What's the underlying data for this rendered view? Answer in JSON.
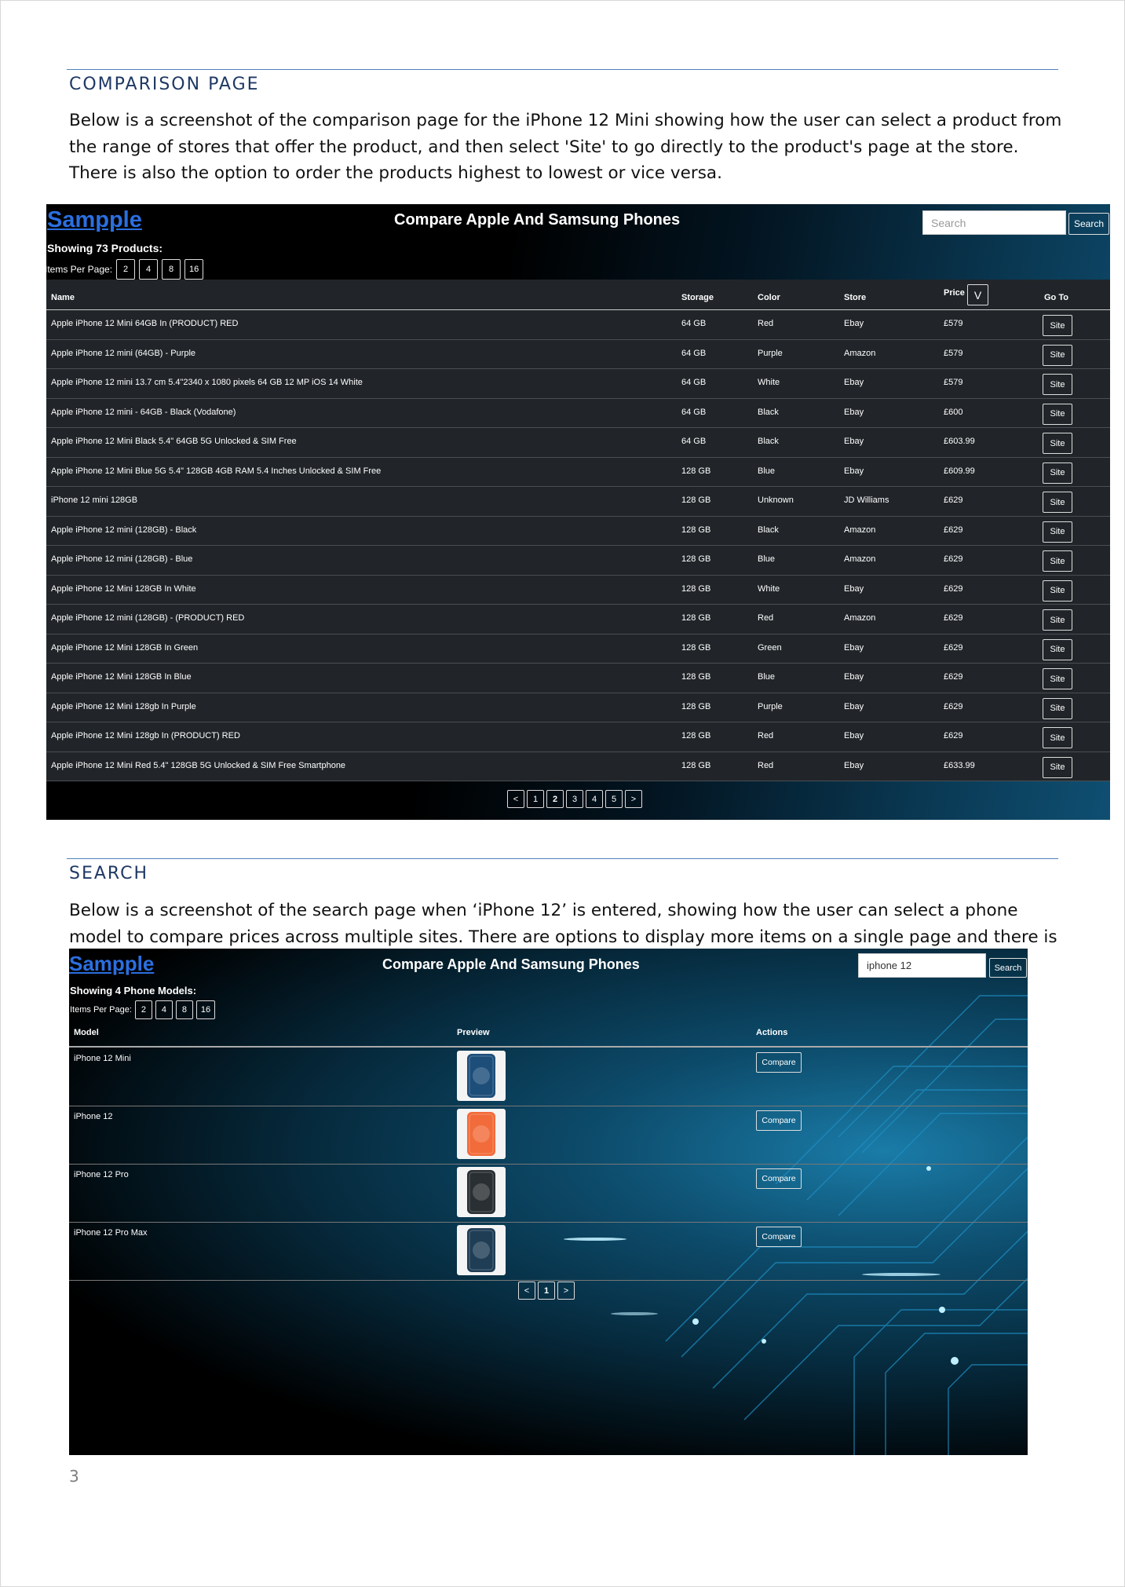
{
  "sections": [
    {
      "heading": "COMPARISON PAGE",
      "paragraph": "Below is a screenshot of the comparison page for the iPhone 12 Mini showing how the user can select a product from the range of stores that offer the product, and then select 'Site' to go directly to the product's page at the store. There is also the option to order the products highest to lowest or vice versa."
    },
    {
      "heading": "SEARCH",
      "paragraph": "Below is a screenshot of the search page when ‘iPhone 12’ is entered, showing how the user can select a phone model to compare prices across multiple sites. There are options to display more items on a single page and there is pagination."
    }
  ],
  "page_number": "3",
  "comparison_app": {
    "logo": "Sampple",
    "title": "Compare Apple And Samsung Phones",
    "search_placeholder": "Search",
    "search_button": "Search",
    "showing": "Showing 73 Products:",
    "items_per_page_label": "Items Per Page:",
    "items_per_page_options": [
      "2",
      "4",
      "8",
      "16"
    ],
    "columns": {
      "name": "Name",
      "storage": "Storage",
      "color": "Color",
      "store": "Store",
      "price": "Price",
      "goto": "Go To"
    },
    "sort_toggle": "V",
    "site_button": "Site",
    "rows": [
      {
        "name": "Apple iPhone 12 Mini 64GB In (PRODUCT) RED",
        "storage": "64 GB",
        "color": "Red",
        "store": "Ebay",
        "price": "£579"
      },
      {
        "name": "Apple iPhone 12 mini (64GB) - Purple",
        "storage": "64 GB",
        "color": "Purple",
        "store": "Amazon",
        "price": "£579"
      },
      {
        "name": "Apple iPhone 12 mini 13.7 cm 5.4\"2340 x 1080 pixels 64 GB 12 MP iOS 14 White",
        "storage": "64 GB",
        "color": "White",
        "store": "Ebay",
        "price": "£579"
      },
      {
        "name": "Apple iPhone 12 mini - 64GB - Black (Vodafone)",
        "storage": "64 GB",
        "color": "Black",
        "store": "Ebay",
        "price": "£600"
      },
      {
        "name": "Apple iPhone 12 Mini Black 5.4\" 64GB 5G Unlocked & SIM Free",
        "storage": "64 GB",
        "color": "Black",
        "store": "Ebay",
        "price": "£603.99"
      },
      {
        "name": "Apple iPhone 12 Mini Blue 5G 5.4\" 128GB 4GB RAM 5.4 Inches Unlocked & SIM Free",
        "storage": "128 GB",
        "color": "Blue",
        "store": "Ebay",
        "price": "£609.99"
      },
      {
        "name": "iPhone 12 mini 128GB",
        "storage": "128 GB",
        "color": "Unknown",
        "store": "JD Williams",
        "price": "£629"
      },
      {
        "name": "Apple iPhone 12 mini (128GB) - Black",
        "storage": "128 GB",
        "color": "Black",
        "store": "Amazon",
        "price": "£629"
      },
      {
        "name": "Apple iPhone 12 mini (128GB) - Blue",
        "storage": "128 GB",
        "color": "Blue",
        "store": "Amazon",
        "price": "£629"
      },
      {
        "name": "Apple iPhone 12 Mini 128GB In White",
        "storage": "128 GB",
        "color": "White",
        "store": "Ebay",
        "price": "£629"
      },
      {
        "name": "Apple iPhone 12 mini (128GB) - (PRODUCT) RED",
        "storage": "128 GB",
        "color": "Red",
        "store": "Amazon",
        "price": "£629"
      },
      {
        "name": "Apple iPhone 12 Mini 128GB In Green",
        "storage": "128 GB",
        "color": "Green",
        "store": "Ebay",
        "price": "£629"
      },
      {
        "name": "Apple iPhone 12 Mini 128GB In Blue",
        "storage": "128 GB",
        "color": "Blue",
        "store": "Ebay",
        "price": "£629"
      },
      {
        "name": "Apple iPhone 12 Mini 128gb In Purple",
        "storage": "128 GB",
        "color": "Purple",
        "store": "Ebay",
        "price": "£629"
      },
      {
        "name": "Apple iPhone 12 Mini 128gb In (PRODUCT) RED",
        "storage": "128 GB",
        "color": "Red",
        "store": "Ebay",
        "price": "£629"
      },
      {
        "name": "Apple iPhone 12 Mini Red 5.4\" 128GB 5G Unlocked & SIM Free Smartphone",
        "storage": "128 GB",
        "color": "Red",
        "store": "Ebay",
        "price": "£633.99"
      }
    ],
    "pagination": [
      "<",
      "1",
      "2",
      "3",
      "4",
      "5",
      ">"
    ],
    "active_page": "2"
  },
  "search_app": {
    "logo": "Sampple",
    "title": "Compare Apple And Samsung Phones",
    "search_value": "iphone 12",
    "search_button": "Search",
    "showing": "Showing 4 Phone Models:",
    "items_per_page_label": "Items Per Page:",
    "items_per_page_options": [
      "2",
      "4",
      "8",
      "16"
    ],
    "columns": {
      "model": "Model",
      "preview": "Preview",
      "actions": "Actions"
    },
    "compare_button": "Compare",
    "models": [
      {
        "name": "iPhone 12 Mini",
        "phone_color": "#1d4e7a"
      },
      {
        "name": "iPhone 12",
        "phone_color": "#f26b3a"
      },
      {
        "name": "iPhone 12 Pro",
        "phone_color": "#2a2f33"
      },
      {
        "name": "iPhone 12 Pro Max",
        "phone_color": "#1f3d55"
      }
    ],
    "pagination": [
      "<",
      "1",
      ">"
    ],
    "active_page": "1"
  }
}
